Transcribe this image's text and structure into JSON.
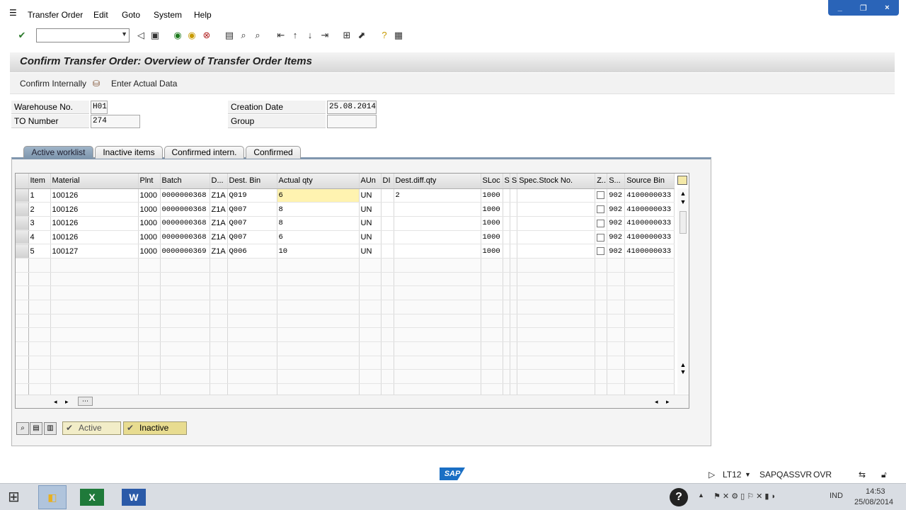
{
  "menu": {
    "items": [
      "Transfer Order",
      "Edit",
      "Goto",
      "System",
      "Help"
    ]
  },
  "window_controls": {
    "minimize": "_",
    "restore": "❐",
    "close": "×"
  },
  "toolbar": {
    "command_field_value": "",
    "icons": [
      "enter-icon",
      "back-icon",
      "save-icon",
      "back-green-icon",
      "exit-icon",
      "cancel-icon",
      "print-icon",
      "find-icon",
      "find-next-icon",
      "first-page-icon",
      "prev-page-icon",
      "next-page-icon",
      "last-page-icon",
      "create-session-icon",
      "shortcut-icon",
      "help-icon",
      "customize-layout-icon"
    ]
  },
  "page": {
    "title": "Confirm Transfer Order: Overview of Transfer Order Items"
  },
  "app_toolbar": {
    "confirm_internally": "Confirm Internally",
    "enter_actual_data": "Enter Actual Data"
  },
  "header": {
    "warehouse_label": "Warehouse No.",
    "warehouse_value": "H01",
    "to_number_label": "TO Number",
    "to_number_value": "274",
    "creation_date_label": "Creation Date",
    "creation_date_value": "25.08.2014",
    "group_label": "Group",
    "group_value": ""
  },
  "tabs": [
    "Active worklist",
    "Inactive items",
    "Confirmed intern.",
    "Confirmed"
  ],
  "table": {
    "columns": [
      "Item",
      "Material",
      "Plnt",
      "Batch",
      "D...",
      "Dest. Bin",
      "Actual qty",
      "AUn",
      "DI",
      "Dest.diff.qty",
      "SLoc",
      "S",
      "S",
      "Spec.Stock No.",
      "Z..",
      "S...",
      "Source Bin"
    ],
    "rows": [
      [
        "1",
        "100126",
        "1000",
        "0000000368",
        "Z1A",
        "Q019",
        "6",
        "UN",
        "",
        "2",
        "1000",
        "",
        "",
        "",
        "",
        "902",
        "4100000033"
      ],
      [
        "2",
        "100126",
        "1000",
        "0000000368",
        "Z1A",
        "Q007",
        "8",
        "UN",
        "",
        "",
        "1000",
        "",
        "",
        "",
        "",
        "902",
        "4100000033"
      ],
      [
        "3",
        "100126",
        "1000",
        "0000000368",
        "Z1A",
        "Q007",
        "8",
        "UN",
        "",
        "",
        "1000",
        "",
        "",
        "",
        "",
        "902",
        "4100000033"
      ],
      [
        "4",
        "100126",
        "1000",
        "0000000368",
        "Z1A",
        "Q007",
        "6",
        "UN",
        "",
        "",
        "1000",
        "",
        "",
        "",
        "",
        "902",
        "4100000033"
      ],
      [
        "5",
        "100127",
        "1000",
        "0000000369",
        "Z1A",
        "Q006",
        "10",
        "UN",
        "",
        "",
        "1000",
        "",
        "",
        "",
        "",
        "902",
        "4100000033"
      ]
    ]
  },
  "bottom_buttons": {
    "active": "Active",
    "inactive": "Inactive"
  },
  "status_bar": {
    "logo": "SAP",
    "transaction": "LT12",
    "server": "SAPQASSVR",
    "mode": "OVR"
  },
  "taskbar": {
    "time": "14:53",
    "date": "25/08/2014",
    "language": "IND"
  }
}
